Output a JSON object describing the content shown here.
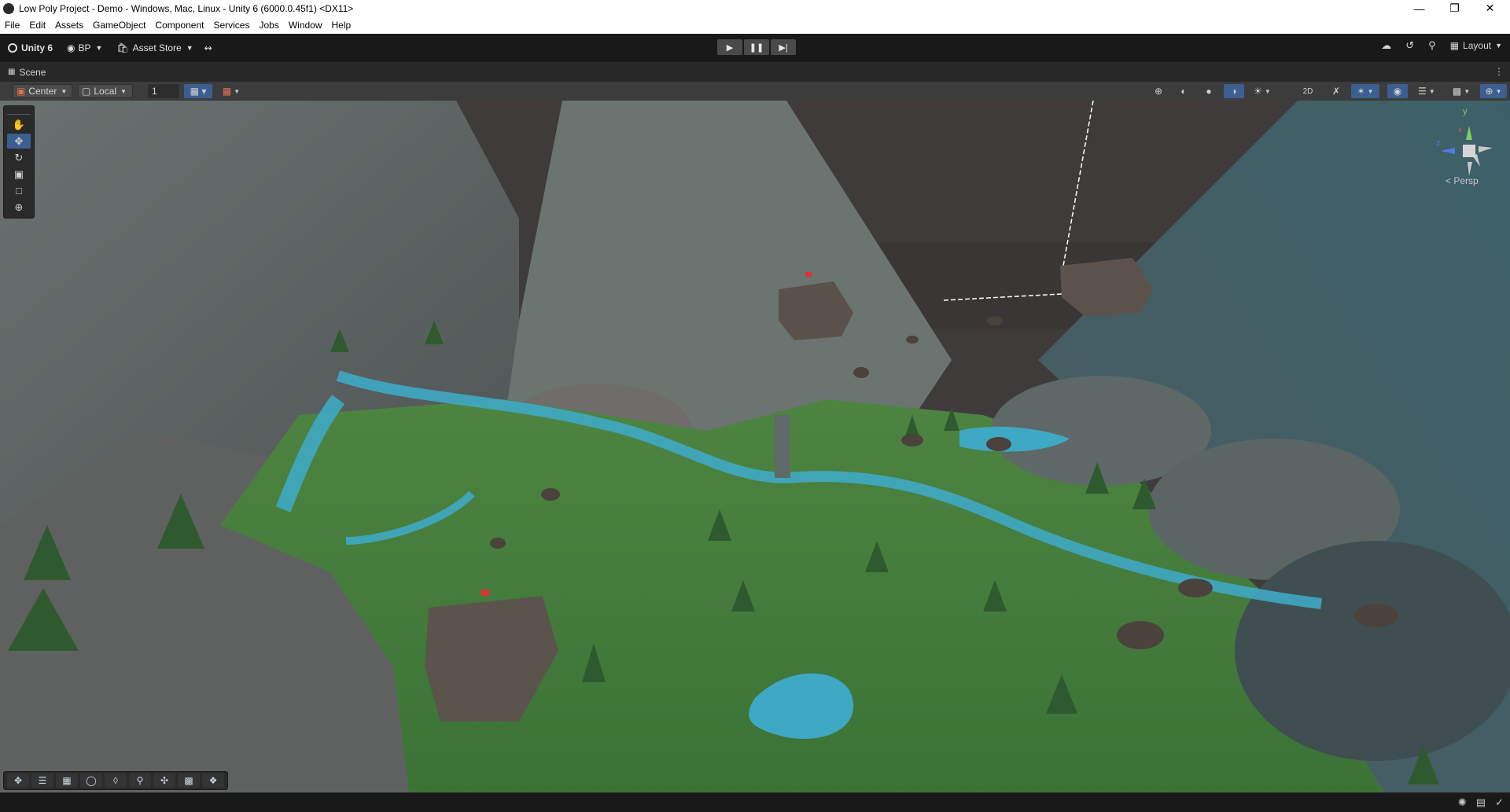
{
  "window": {
    "title": "Low Poly Project - Demo - Windows, Mac, Linux - Unity 6 (6000.0.45f1) <DX11>",
    "minimize_icon": "minimize-icon",
    "maximize_icon": "restore-icon",
    "close_icon": "close-icon"
  },
  "menu": [
    "File",
    "Edit",
    "Assets",
    "GameObject",
    "Component",
    "Services",
    "Jobs",
    "Window",
    "Help"
  ],
  "toolbar": {
    "unity_label": "Unity 6",
    "account_label": "BP",
    "asset_store_label": "Asset Store",
    "layout_label": "Layout"
  },
  "tabs": {
    "scene_label": "Scene"
  },
  "scene_toolbar": {
    "pivot_label": "Center",
    "space_label": "Local",
    "grid_snap_value": "1"
  },
  "gizmo": {
    "y_label": "y",
    "z_label": "z",
    "x_label": "x",
    "projection_label": "< Persp"
  },
  "colors": {
    "accent": "#3c5f91",
    "water": "#3fa8c4",
    "grass": "#3f7c3c",
    "rock": "#6e6a64"
  }
}
